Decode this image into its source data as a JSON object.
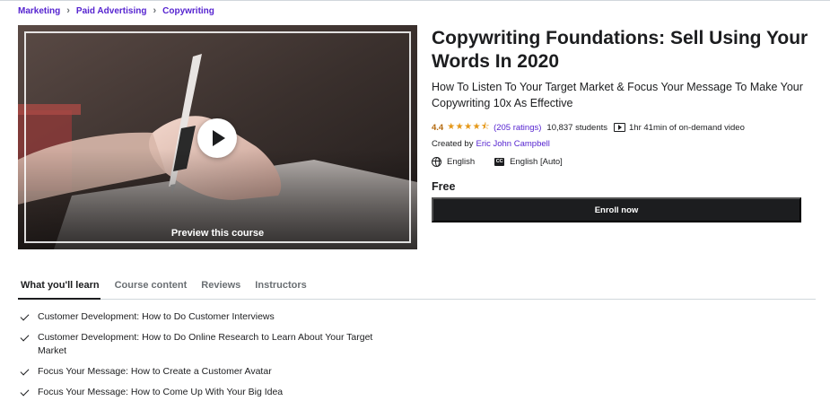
{
  "breadcrumb": [
    {
      "label": "Marketing"
    },
    {
      "label": "Paid Advertising"
    },
    {
      "label": "Copywriting"
    }
  ],
  "breadcrumb_separator": "›",
  "preview": {
    "label": "Preview this course",
    "play_icon": "play-icon"
  },
  "course": {
    "title": "Copywriting Foundations: Sell Using Your Words In 2020",
    "subtitle": "How To Listen To Your Target Market & Focus Your Message To Make Your Copywriting 10x As Effective",
    "rating": "4.4",
    "stars": "★★★★⯪",
    "rating_count": "(205 ratings)",
    "students": "10,837 students",
    "duration": "1hr 41min of on-demand video",
    "created_by_label": "Created by",
    "author": "Eric John Campbell",
    "language": "English",
    "captions": "English [Auto]",
    "cc_badge": "CC"
  },
  "purchase": {
    "price": "Free",
    "enroll_label": "Enroll now"
  },
  "tabs": [
    {
      "label": "What you'll learn",
      "active": true
    },
    {
      "label": "Course content",
      "active": false
    },
    {
      "label": "Reviews",
      "active": false
    },
    {
      "label": "Instructors",
      "active": false
    }
  ],
  "learn_items": [
    "Customer Development: How to Do Customer Interviews",
    "Customer Development: How to Do Online Research to Learn About Your Target Market",
    "Focus Your Message: How to Create a Customer Avatar",
    "Focus Your Message: How to Come Up With Your Big Idea"
  ],
  "colors": {
    "link": "#5624d0",
    "rating": "#b4690e",
    "star": "#e59819",
    "button": "#1c1d1f",
    "text": "#1c1d1f"
  }
}
